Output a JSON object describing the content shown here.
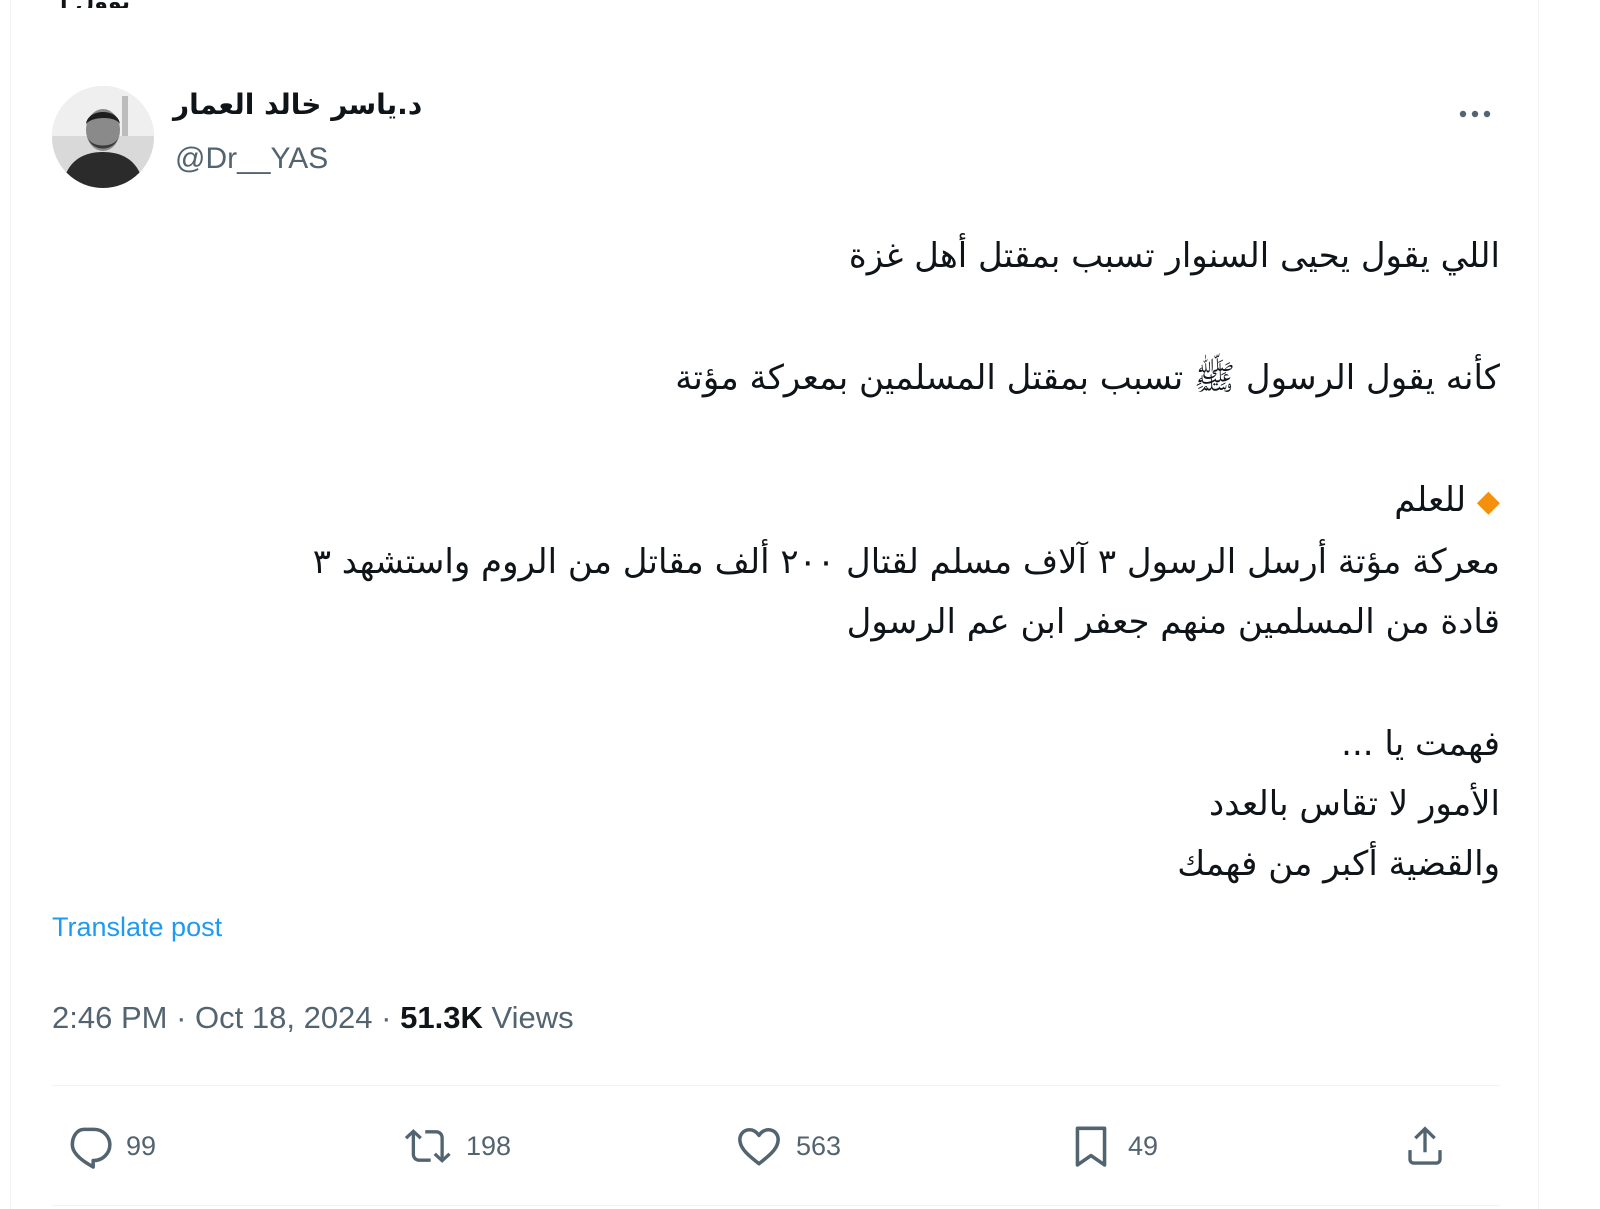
{
  "top_partial_text": "بوول ا",
  "author": {
    "display_name": "د.ياسر خالد العمار",
    "handle": "@Dr__YAS"
  },
  "tweet": {
    "line1": "اللي يقول يحيى السنوار تسبب بمقتل أهل غزة",
    "line2": "كأنه يقول الرسول ﷺ تسبب بمقتل المسلمين بمعركة مؤتة",
    "line3_emoji": "◆",
    "line3_text": "للعلم",
    "line4": "معركة مؤتة أرسل الرسول ٣ آلاف مسلم لقتال ٢٠٠ ألف مقاتل من الروم واستشهد ٣",
    "line5": "قادة من المسلمين منهم جعفر ابن عم الرسول",
    "line6": "فهمت يا ...",
    "line7": "الأمور لا تقاس بالعدد",
    "line8": "والقضية أكبر من فهمك"
  },
  "translate_label": "Translate post",
  "meta": {
    "time": "2:46 PM",
    "separator": "·",
    "date": "Oct 18, 2024",
    "views_count": "51.3K",
    "views_label": "Views"
  },
  "actions": {
    "replies": "99",
    "reposts": "198",
    "likes": "563",
    "bookmarks": "49"
  },
  "icons": {
    "reply": "reply-bubble-icon",
    "repost": "repost-arrows-icon",
    "like": "heart-icon",
    "bookmark": "bookmark-icon",
    "share": "share-upload-icon",
    "more": "more-dots-icon"
  },
  "colors": {
    "link": "#1d9bf0",
    "secondary_text": "#536471",
    "primary_text": "#0f1419",
    "diamond": "#f4900c"
  }
}
